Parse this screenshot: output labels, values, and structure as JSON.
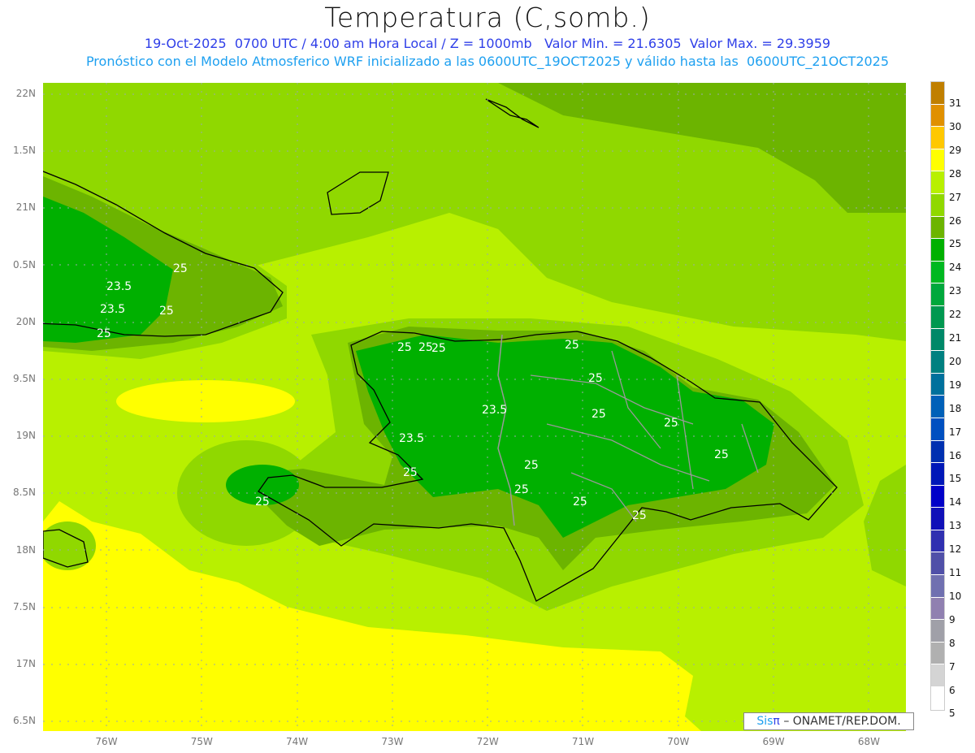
{
  "title": "Temperatura (C,somb.)",
  "subtitle1": "19-Oct-2025  0700 UTC / 4:00 am Hora Local / Z = 1000mb   Valor Min. = 21.6305  Valor Max. = 29.3959",
  "subtitle2": "Pronóstico con el Modelo Atmosferico WRF inicializado a las 0600UTC_19OCT2025 y válido hasta las  0600UTC_21OCT2025",
  "lat_labels": [
    "22N",
    "1.5N",
    "21N",
    "0.5N",
    "20N",
    "9.5N",
    "19N",
    "8.5N",
    "18N",
    "7.5N",
    "17N",
    "6.5N"
  ],
  "lon_labels": [
    "76W",
    "75W",
    "74W",
    "73W",
    "72W",
    "71W",
    "70W",
    "69W",
    "68W"
  ],
  "colorbar": {
    "labels": [
      "31",
      "30",
      "29",
      "28",
      "27",
      "26",
      "25",
      "24",
      "23",
      "22",
      "21",
      "20",
      "19",
      "18",
      "17",
      "16",
      "15",
      "14",
      "13",
      "12",
      "11",
      "10",
      "9",
      "8",
      "7",
      "6",
      "5"
    ],
    "colors": [
      "#c07f00",
      "#e09000",
      "#ffc800",
      "#ffff00",
      "#b8f000",
      "#90d800",
      "#6cb400",
      "#00b000",
      "#00b820",
      "#00a83c",
      "#009850",
      "#008868",
      "#008080",
      "#00709c",
      "#0060b8",
      "#0050c0",
      "#0030b0",
      "#0018b8",
      "#0000c8",
      "#1010b8",
      "#3030b0",
      "#5050a8",
      "#7070b0",
      "#9080b0",
      "#a0a0a8",
      "#b0b0b0",
      "#d4d4d4",
      "#ffffff"
    ]
  },
  "contour_labels": [
    "25",
    "23.5",
    "23.5",
    "25",
    "25",
    "25",
    "25",
    "25",
    "25",
    "23.5",
    "25",
    "25",
    "23.5",
    "25",
    "25",
    "25",
    "25",
    "25",
    "25",
    "25",
    "25"
  ],
  "credit": {
    "brand_a": "Sis",
    "brand_b": "π",
    "text": "– ONAMET/REP.DOM."
  }
}
